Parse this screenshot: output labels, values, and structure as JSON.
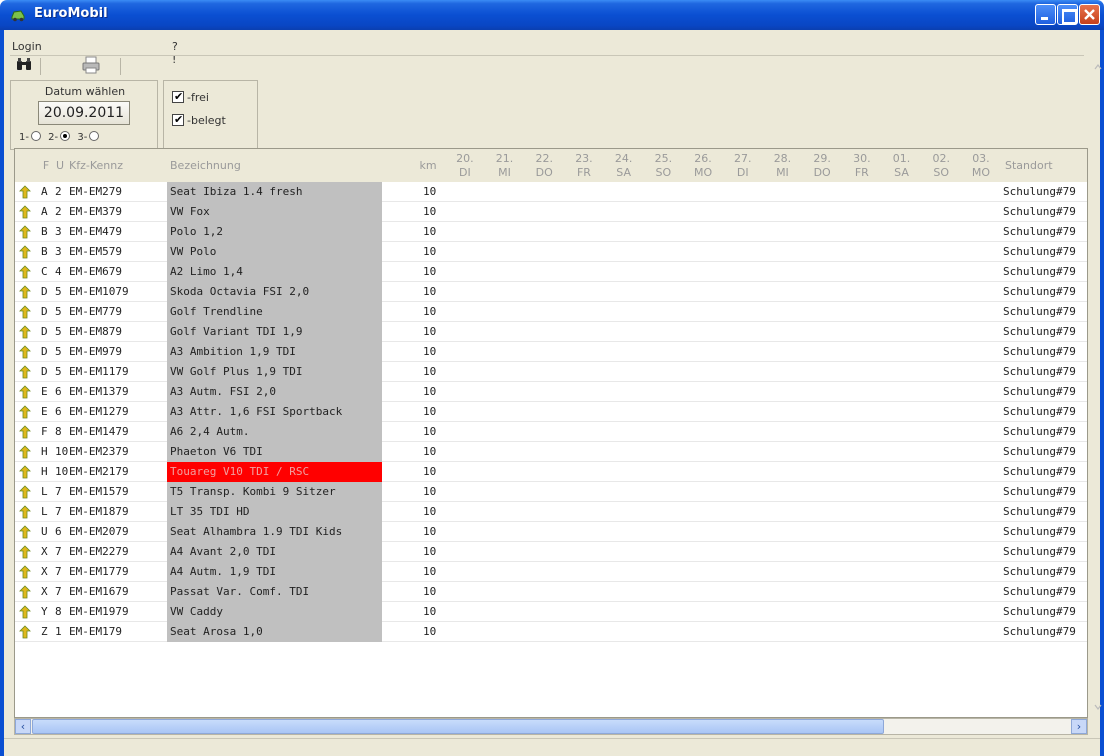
{
  "window": {
    "title": "EuroMobil"
  },
  "menu": {
    "login": "Login",
    "help": "? !"
  },
  "options": {
    "date_label": "Datum wählen",
    "date_value": "20.09.2011",
    "radios": [
      {
        "label": "1-",
        "selected": false
      },
      {
        "label": "2-",
        "selected": true
      },
      {
        "label": "3-",
        "selected": false
      }
    ],
    "checkboxes": [
      {
        "label": "-frei",
        "checked": true
      },
      {
        "label": "-belegt",
        "checked": true
      }
    ]
  },
  "grid": {
    "headers": {
      "f": "F",
      "u": "U",
      "kfz": "Kfz-Kennz",
      "bezeichnung": "Bezeichnung",
      "km": "km",
      "standort": "Standort"
    },
    "days": [
      {
        "d": "20.",
        "w": "DI"
      },
      {
        "d": "21.",
        "w": "MI"
      },
      {
        "d": "22.",
        "w": "DO"
      },
      {
        "d": "23.",
        "w": "FR"
      },
      {
        "d": "24.",
        "w": "SA"
      },
      {
        "d": "25.",
        "w": "SO"
      },
      {
        "d": "26.",
        "w": "MO"
      },
      {
        "d": "27.",
        "w": "DI"
      },
      {
        "d": "28.",
        "w": "MI"
      },
      {
        "d": "29.",
        "w": "DO"
      },
      {
        "d": "30.",
        "w": "FR"
      },
      {
        "d": "01.",
        "w": "SA"
      },
      {
        "d": "02.",
        "w": "SO"
      },
      {
        "d": "03.",
        "w": "MO"
      }
    ],
    "rows": [
      {
        "f": "A",
        "u": "2",
        "kfz": "EM-EM279",
        "desc": "Seat Ibiza 1.4 fresh",
        "km": "10",
        "standort": "Schulung#79",
        "highlight": false
      },
      {
        "f": "A",
        "u": "2",
        "kfz": "EM-EM379",
        "desc": "VW Fox",
        "km": "10",
        "standort": "Schulung#79",
        "highlight": false
      },
      {
        "f": "B",
        "u": "3",
        "kfz": "EM-EM479",
        "desc": "Polo 1,2",
        "km": "10",
        "standort": "Schulung#79",
        "highlight": false
      },
      {
        "f": "B",
        "u": "3",
        "kfz": "EM-EM579",
        "desc": "VW Polo",
        "km": "10",
        "standort": "Schulung#79",
        "highlight": false
      },
      {
        "f": "C",
        "u": "4",
        "kfz": "EM-EM679",
        "desc": "A2 Limo 1,4",
        "km": "10",
        "standort": "Schulung#79",
        "highlight": false
      },
      {
        "f": "D",
        "u": "5",
        "kfz": "EM-EM1079",
        "desc": "Skoda Octavia FSI 2,0",
        "km": "10",
        "standort": "Schulung#79",
        "highlight": false
      },
      {
        "f": "D",
        "u": "5",
        "kfz": "EM-EM779",
        "desc": "Golf Trendline",
        "km": "10",
        "standort": "Schulung#79",
        "highlight": false
      },
      {
        "f": "D",
        "u": "5",
        "kfz": "EM-EM879",
        "desc": "Golf Variant TDI 1,9",
        "km": "10",
        "standort": "Schulung#79",
        "highlight": false
      },
      {
        "f": "D",
        "u": "5",
        "kfz": "EM-EM979",
        "desc": "A3 Ambition 1,9 TDI",
        "km": "10",
        "standort": "Schulung#79",
        "highlight": false
      },
      {
        "f": "D",
        "u": "5",
        "kfz": "EM-EM1179",
        "desc": "VW Golf Plus 1,9 TDI",
        "km": "10",
        "standort": "Schulung#79",
        "highlight": false
      },
      {
        "f": "E",
        "u": "6",
        "kfz": "EM-EM1379",
        "desc": "A3 Autm. FSI 2,0",
        "km": "10",
        "standort": "Schulung#79",
        "highlight": false
      },
      {
        "f": "E",
        "u": "6",
        "kfz": "EM-EM1279",
        "desc": "A3 Attr. 1,6 FSI Sportback",
        "km": "10",
        "standort": "Schulung#79",
        "highlight": false
      },
      {
        "f": "F",
        "u": "8",
        "kfz": "EM-EM1479",
        "desc": "A6 2,4 Autm.",
        "km": "10",
        "standort": "Schulung#79",
        "highlight": false
      },
      {
        "f": "H",
        "u": "10",
        "kfz": "EM-EM2379",
        "desc": "Phaeton V6 TDI",
        "km": "10",
        "standort": "Schulung#79",
        "highlight": false
      },
      {
        "f": "H",
        "u": "10",
        "kfz": "EM-EM2179",
        "desc": "Touareg V10 TDI / RSC",
        "km": "10",
        "standort": "Schulung#79",
        "highlight": true
      },
      {
        "f": "L",
        "u": "7",
        "kfz": "EM-EM1579",
        "desc": "T5 Transp. Kombi 9 Sitzer",
        "km": "10",
        "standort": "Schulung#79",
        "highlight": false
      },
      {
        "f": "L",
        "u": "7",
        "kfz": "EM-EM1879",
        "desc": "LT 35 TDI HD",
        "km": "10",
        "standort": "Schulung#79",
        "highlight": false
      },
      {
        "f": "U",
        "u": "6",
        "kfz": "EM-EM2079",
        "desc": "Seat Alhambra 1.9 TDI Kids",
        "km": "10",
        "standort": "Schulung#79",
        "highlight": false
      },
      {
        "f": "X",
        "u": "7",
        "kfz": "EM-EM2279",
        "desc": "A4 Avant 2,0 TDI",
        "km": "10",
        "standort": "Schulung#79",
        "highlight": false
      },
      {
        "f": "X",
        "u": "7",
        "kfz": "EM-EM1779",
        "desc": "A4 Autm. 1,9 TDI",
        "km": "10",
        "standort": "Schulung#79",
        "highlight": false
      },
      {
        "f": "X",
        "u": "7",
        "kfz": "EM-EM1679",
        "desc": "Passat Var. Comf. TDI",
        "km": "10",
        "standort": "Schulung#79",
        "highlight": false
      },
      {
        "f": "Y",
        "u": "8",
        "kfz": "EM-EM1979",
        "desc": "VW Caddy",
        "km": "10",
        "standort": "Schulung#79",
        "highlight": false
      },
      {
        "f": "Z",
        "u": "1",
        "kfz": "EM-EM179",
        "desc": "Seat Arosa 1,0",
        "km": "10",
        "standort": "Schulung#79",
        "highlight": false
      }
    ]
  },
  "icons": {
    "app": "car-icon",
    "find": "binoculars-icon",
    "print": "printer-icon",
    "row": "vehicle-status-icon"
  },
  "colors": {
    "titlebar": "#0a4fd2",
    "highlight_row": "#ff0000",
    "desc_bg": "#c0c0c0"
  }
}
